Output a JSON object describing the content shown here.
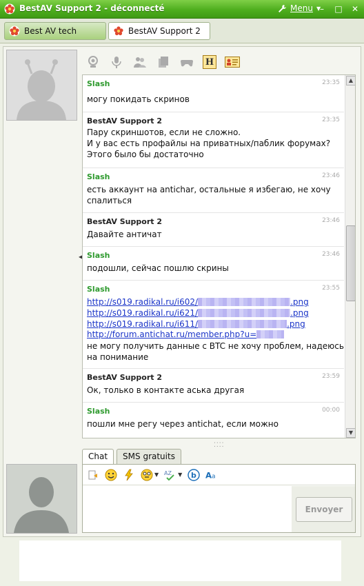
{
  "window": {
    "title": "BestAV Support 2 - déconnecté",
    "menu_label": "Menu",
    "minimize": "–",
    "maximize": "□",
    "close": "✕"
  },
  "tabs": [
    {
      "label": "Best AV tech"
    },
    {
      "label": "BestAV Support 2"
    }
  ],
  "toolbar": {
    "h_button": "H"
  },
  "messages": [
    {
      "sender": "Slash",
      "time": "23:35",
      "lines": [
        "могу покидать скринов"
      ]
    },
    {
      "sender": "BestAV Support 2",
      "time": "23:35",
      "lines": [
        "Пару скриншотов, если не сложно.",
        "И у вас есть профайлы на приватных/паблик форумах?",
        "Этого было бы достаточно"
      ]
    },
    {
      "sender": "Slash",
      "time": "23:46",
      "lines": [
        "есть аккаунт на antichar, остальные я избегаю, не хочу",
        "спалиться"
      ]
    },
    {
      "sender": "BestAV Support 2",
      "time": "23:46",
      "lines": [
        "Давайте античат"
      ]
    },
    {
      "sender": "Slash",
      "time": "23:46",
      "lines": [
        "подошли, сейчас пошлю скрины"
      ]
    },
    {
      "sender": "Slash",
      "time": "23:55",
      "links": [
        {
          "prefix": "http://s019.radikal.ru/i602/",
          "suffix": ".png"
        },
        {
          "prefix": "http://s019.radikal.ru/i621/",
          "suffix": ".png"
        },
        {
          "prefix": "http://s019.radikal.ru/i611/",
          "suffix": ".png"
        },
        {
          "prefix": "http://forum.antichat.ru/member.php?u=",
          "suffix": ""
        }
      ],
      "lines": [
        "не могу получить данные с BTC не хочу проблем, надеюсь",
        "на понимание"
      ]
    },
    {
      "sender": "BestAV Support 2",
      "time": "23:59",
      "lines": [
        "Ок, только в контакте аська другая"
      ]
    },
    {
      "sender": "Slash",
      "time": "00:00",
      "lines": [
        "пошли мне регу через antichat, если можно"
      ]
    }
  ],
  "input": {
    "tab_chat": "Chat",
    "tab_sms": "SMS gratuits",
    "send_label": "Envoyer"
  },
  "colors": {
    "titlebar": "#4eae1e",
    "slash_name": "#2e9a2e",
    "link": "#1a34c8"
  }
}
